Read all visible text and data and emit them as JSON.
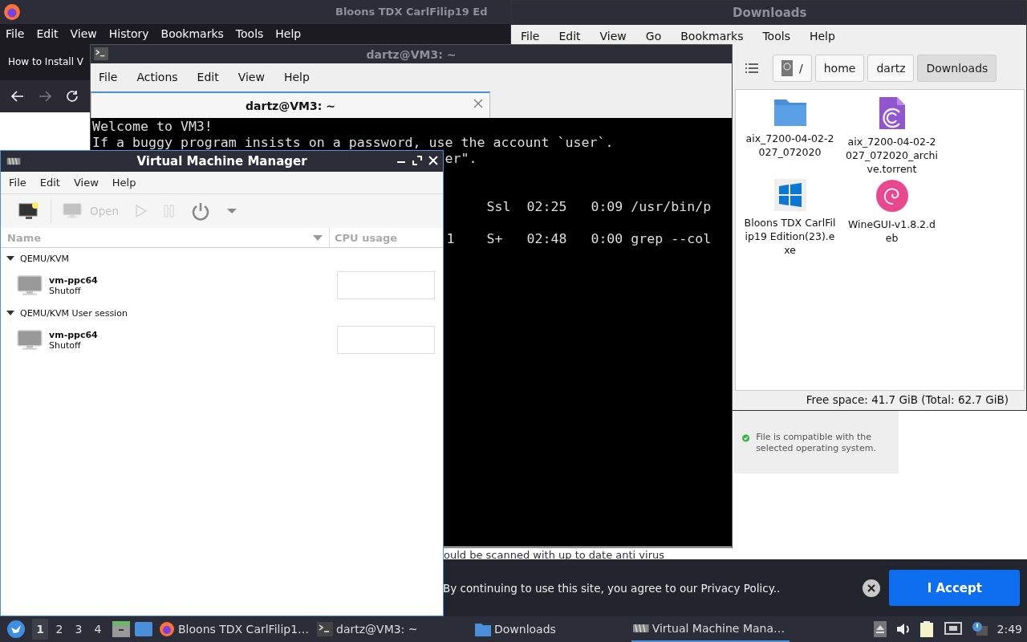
{
  "browser": {
    "title": "Bloons TDX CarlFilip19 Ed",
    "menu": [
      "File",
      "Edit",
      "View",
      "History",
      "Bookmarks",
      "Tools",
      "Help"
    ],
    "tab": "How to Install V",
    "page_text": "ould be scanned with up to date anti virus",
    "notice": "File is compatible with the selected operating system.",
    "cookie_banner": {
      "text": "By continuing to use this site, you agree to our Privacy Policy..",
      "accept": "I Accept"
    }
  },
  "file_manager": {
    "title": "Downloads",
    "menu": [
      "File",
      "Edit",
      "View",
      "Go",
      "Bookmarks",
      "Tools",
      "Help"
    ],
    "path": [
      {
        "label": "/",
        "kind": "root",
        "selected": false
      },
      {
        "label": "home",
        "kind": "dir",
        "selected": false
      },
      {
        "label": "dartz",
        "kind": "dir",
        "selected": false
      },
      {
        "label": "Downloads",
        "kind": "dir",
        "selected": true
      }
    ],
    "files": [
      {
        "name": "aix_7200-04-02-2027_072020",
        "kind": "folder"
      },
      {
        "name": "aix_7200-04-02-2027_072020_archive.torrent",
        "kind": "torrent"
      },
      {
        "name": "Bloons TDX CarlFilip19 Edition(23).exe",
        "kind": "exe"
      },
      {
        "name": "WineGUI-v1.8.2.deb",
        "kind": "deb"
      }
    ],
    "status": "Free space: 41.7 GiB (Total: 62.7 GiB)"
  },
  "terminal": {
    "title": "dartz@VM3: ~",
    "menu": [
      "File",
      "Actions",
      "Edit",
      "View",
      "Help"
    ],
    "tab": {
      "label": "dartz@VM3: ~",
      "selected": true
    },
    "lines": [
      {
        "kind": "full",
        "text": "Welcome to VM3!"
      },
      {
        "kind": "full",
        "text": "If a buggy program insists on a password, use the account `user`."
      },
      {
        "kind": "covered",
        "text": "er\"."
      },
      {
        "kind": "blank"
      },
      {
        "kind": "blank"
      },
      {
        "kind": "process",
        "text": "Ssl  02:25   0:09 /usr/bin/p"
      },
      {
        "kind": "blank"
      },
      {
        "kind": "process",
        "text": "1    S+   02:48   0:00 grep --col"
      }
    ]
  },
  "vmm": {
    "title": "Virtual Machine Manager",
    "menu": [
      "File",
      "Edit",
      "View",
      "Help"
    ],
    "toolbar": [
      {
        "kind": "new",
        "disabled": false
      },
      {
        "kind": "open",
        "label": "Open",
        "disabled": true
      },
      {
        "kind": "run",
        "disabled": true
      },
      {
        "kind": "pause",
        "disabled": true
      },
      {
        "kind": "shutdown",
        "disabled": false
      },
      {
        "kind": "dropdown",
        "disabled": false
      }
    ],
    "columns": [
      "Name",
      "CPU usage"
    ],
    "groups": [
      {
        "name": "QEMU/KVM",
        "expanded": true,
        "vms": [
          {
            "name": "vm-ppc64",
            "status": "Shutoff"
          }
        ]
      },
      {
        "name": "QEMU/KVM User session",
        "expanded": true,
        "vms": [
          {
            "name": "vm-ppc64",
            "status": "Shutoff"
          }
        ]
      }
    ]
  },
  "taskbar": {
    "workspaces": [
      {
        "label": "1",
        "selected": true
      },
      {
        "label": "2",
        "selected": false
      },
      {
        "label": "3",
        "selected": false
      },
      {
        "label": "4",
        "selected": false
      }
    ],
    "tasks": [
      {
        "label": "Bloons TDX CarlFilip1…",
        "kind": "browser",
        "selected": false
      },
      {
        "label": "dartz@VM3: ~",
        "kind": "terminal",
        "selected": false
      },
      {
        "label": "Downloads",
        "kind": "folder",
        "selected": false
      },
      {
        "label": "Virtual Machine Mana…",
        "kind": "vmm",
        "selected": true
      }
    ],
    "clock": "2:49"
  }
}
